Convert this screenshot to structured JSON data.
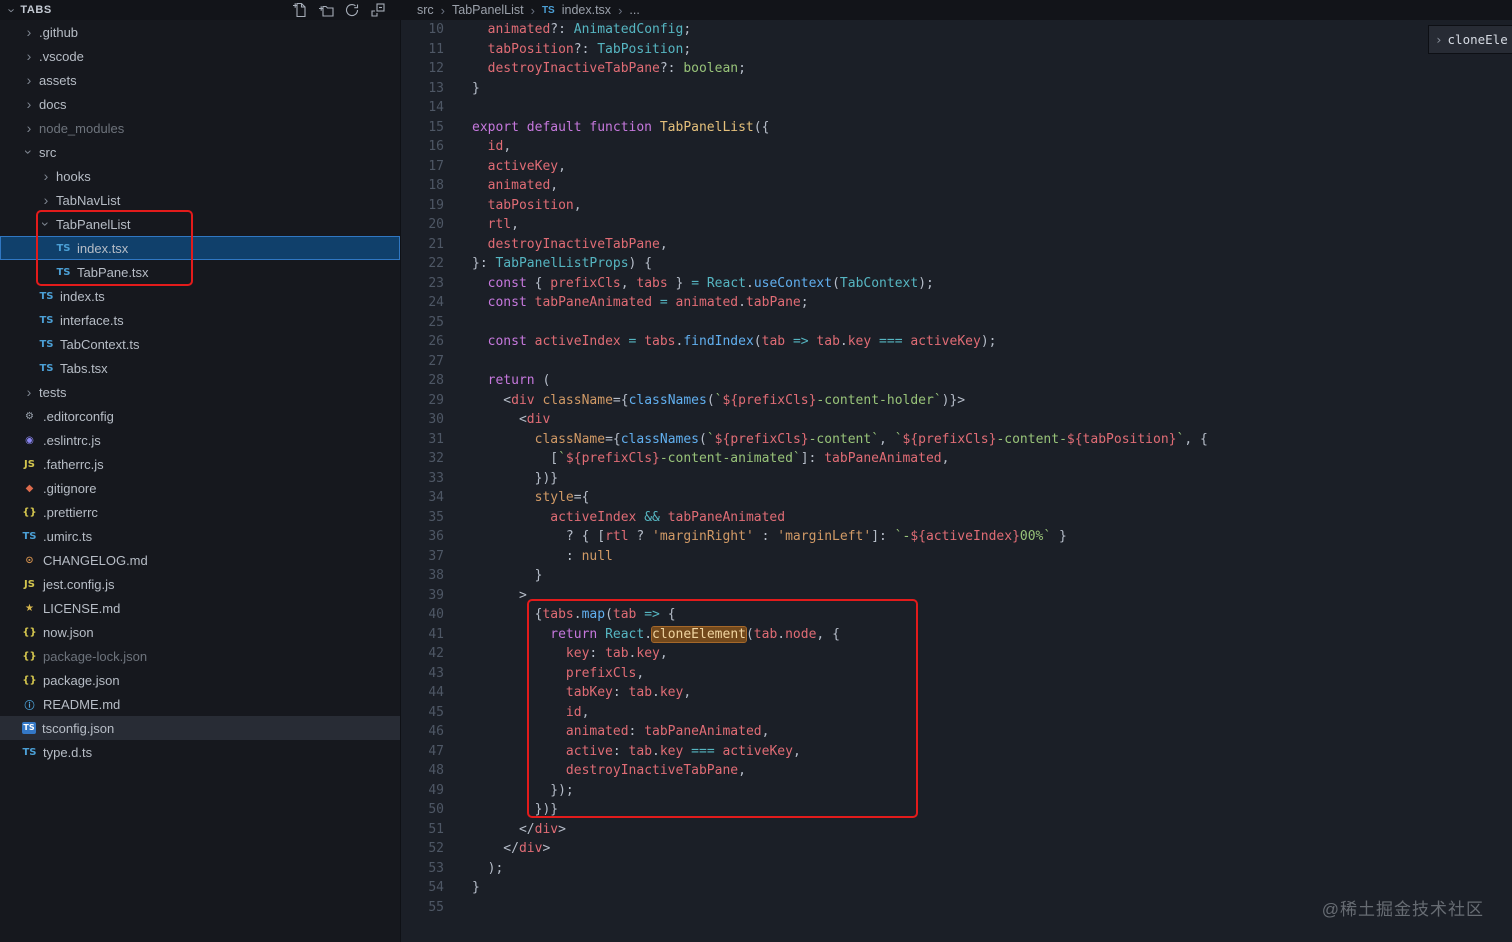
{
  "explorer": {
    "title": "TABS",
    "actions": [
      "new-file-icon",
      "new-folder-icon",
      "refresh-icon",
      "collapse-all-icon"
    ],
    "items": [
      {
        "label": ".github",
        "kind": "folder",
        "level": 0
      },
      {
        "label": ".vscode",
        "kind": "folder",
        "level": 0
      },
      {
        "label": "assets",
        "kind": "folder",
        "level": 0
      },
      {
        "label": "docs",
        "kind": "folder",
        "level": 0
      },
      {
        "label": "node_modules",
        "kind": "folder",
        "level": 0,
        "dim": true
      },
      {
        "label": "src",
        "kind": "folder",
        "level": 0,
        "expanded": true
      },
      {
        "label": "hooks",
        "kind": "folder",
        "level": 1
      },
      {
        "label": "TabNavList",
        "kind": "folder",
        "level": 1
      },
      {
        "label": "TabPanelList",
        "kind": "folder",
        "level": 1,
        "expanded": true
      },
      {
        "label": "index.tsx",
        "kind": "file",
        "icon": "ts",
        "level": 2,
        "selected": true
      },
      {
        "label": "TabPane.tsx",
        "kind": "file",
        "icon": "ts",
        "level": 2
      },
      {
        "label": "index.ts",
        "kind": "file",
        "icon": "ts",
        "level": 1
      },
      {
        "label": "interface.ts",
        "kind": "file",
        "icon": "ts",
        "level": 1
      },
      {
        "label": "TabContext.ts",
        "kind": "file",
        "icon": "ts",
        "level": 1
      },
      {
        "label": "Tabs.tsx",
        "kind": "file",
        "icon": "ts",
        "level": 1
      },
      {
        "label": "tests",
        "kind": "folder",
        "level": 0
      },
      {
        "label": ".editorconfig",
        "kind": "file",
        "icon": "gear",
        "level": 0
      },
      {
        "label": ".eslintrc.js",
        "kind": "file",
        "icon": "eslint",
        "level": 0
      },
      {
        "label": ".fatherrc.js",
        "kind": "file",
        "icon": "js",
        "level": 0
      },
      {
        "label": ".gitignore",
        "kind": "file",
        "icon": "git",
        "level": 0
      },
      {
        "label": ".prettierrc",
        "kind": "file",
        "icon": "json",
        "level": 0
      },
      {
        "label": ".umirc.ts",
        "kind": "file",
        "icon": "ts",
        "level": 0
      },
      {
        "label": "CHANGELOG.md",
        "kind": "file",
        "icon": "changelog",
        "level": 0
      },
      {
        "label": "jest.config.js",
        "kind": "file",
        "icon": "js",
        "level": 0
      },
      {
        "label": "LICENSE.md",
        "kind": "file",
        "icon": "license",
        "level": 0
      },
      {
        "label": "now.json",
        "kind": "file",
        "icon": "json",
        "level": 0
      },
      {
        "label": "package-lock.json",
        "kind": "file",
        "icon": "json",
        "level": 0,
        "dim": true
      },
      {
        "label": "package.json",
        "kind": "file",
        "icon": "json",
        "level": 0
      },
      {
        "label": "README.md",
        "kind": "file",
        "icon": "info",
        "level": 0
      },
      {
        "label": "tsconfig.json",
        "kind": "file",
        "icon": "tsconfig",
        "level": 0,
        "active": true
      },
      {
        "label": "type.d.ts",
        "kind": "file",
        "icon": "ts",
        "level": 0
      }
    ]
  },
  "icon_glyphs": {
    "ts": {
      "glyph": "TS",
      "color": "#4b9fd5"
    },
    "tsconfig": {
      "glyph": "TS",
      "color": "#ffffff",
      "bg": "#3478c6"
    },
    "js": {
      "glyph": "JS",
      "color": "#d4c64e"
    },
    "json": {
      "glyph": "{}",
      "color": "#d4c64e"
    },
    "gear": {
      "glyph": "⚙",
      "color": "#9da5b0"
    },
    "eslint": {
      "glyph": "◉",
      "color": "#8a85f0"
    },
    "git": {
      "glyph": "◆",
      "color": "#dd6b4d"
    },
    "info": {
      "glyph": "ⓘ",
      "color": "#4b9fd5"
    },
    "changelog": {
      "glyph": "⊙",
      "color": "#c98a4b"
    },
    "license": {
      "glyph": "★",
      "color": "#d8b84e"
    },
    "ts_badge": "TS"
  },
  "breadcrumb": {
    "parts": [
      "src",
      "TabPanelList",
      "index.tsx",
      "..."
    ]
  },
  "peek_widget": {
    "text": "cloneEle"
  },
  "watermark": {
    "text": "@稀土掘金技术社区"
  },
  "editor": {
    "first_line": 10,
    "lines": [
      [
        [
          "pl",
          "  "
        ],
        [
          "va",
          "animated"
        ],
        [
          "pl",
          "?: "
        ],
        [
          "ty",
          "AnimatedConfig"
        ],
        [
          "pl",
          ";"
        ]
      ],
      [
        [
          "pl",
          "  "
        ],
        [
          "va",
          "tabPosition"
        ],
        [
          "pl",
          "?: "
        ],
        [
          "ty",
          "TabPosition"
        ],
        [
          "pl",
          ";"
        ]
      ],
      [
        [
          "pl",
          "  "
        ],
        [
          "va",
          "destroyInactiveTabPane"
        ],
        [
          "pl",
          "?: "
        ],
        [
          "st",
          "boolean"
        ],
        [
          "pl",
          ";"
        ]
      ],
      [
        [
          "pl",
          "}"
        ]
      ],
      [],
      [
        [
          "kw",
          "export default function "
        ],
        [
          "au",
          "TabPanelList"
        ],
        [
          "pl",
          "({"
        ]
      ],
      [
        [
          "pl",
          "  "
        ],
        [
          "va",
          "id"
        ],
        [
          "pl",
          ","
        ]
      ],
      [
        [
          "pl",
          "  "
        ],
        [
          "va",
          "activeKey"
        ],
        [
          "pl",
          ","
        ]
      ],
      [
        [
          "pl",
          "  "
        ],
        [
          "va",
          "animated"
        ],
        [
          "pl",
          ","
        ]
      ],
      [
        [
          "pl",
          "  "
        ],
        [
          "va",
          "tabPosition"
        ],
        [
          "pl",
          ","
        ]
      ],
      [
        [
          "pl",
          "  "
        ],
        [
          "va",
          "rtl"
        ],
        [
          "pl",
          ","
        ]
      ],
      [
        [
          "pl",
          "  "
        ],
        [
          "va",
          "destroyInactiveTabPane"
        ],
        [
          "pl",
          ","
        ]
      ],
      [
        [
          "pl",
          "}: "
        ],
        [
          "ty",
          "TabPanelListProps"
        ],
        [
          "pl",
          ") {"
        ]
      ],
      [
        [
          "pl",
          "  "
        ],
        [
          "kw",
          "const"
        ],
        [
          "pl",
          " { "
        ],
        [
          "va",
          "prefixCls"
        ],
        [
          "pl",
          ", "
        ],
        [
          "va",
          "tabs"
        ],
        [
          "pl",
          " } "
        ],
        [
          "op",
          "="
        ],
        [
          "pl",
          " "
        ],
        [
          "ty",
          "React"
        ],
        [
          "pl",
          "."
        ],
        [
          "fn",
          "useContext"
        ],
        [
          "pl",
          "("
        ],
        [
          "ty",
          "TabContext"
        ],
        [
          "pl",
          ");"
        ]
      ],
      [
        [
          "pl",
          "  "
        ],
        [
          "kw",
          "const"
        ],
        [
          "pl",
          " "
        ],
        [
          "va",
          "tabPaneAnimated"
        ],
        [
          "pl",
          " "
        ],
        [
          "op",
          "="
        ],
        [
          "pl",
          " "
        ],
        [
          "va",
          "animated"
        ],
        [
          "pl",
          "."
        ],
        [
          "va",
          "tabPane"
        ],
        [
          "pl",
          ";"
        ]
      ],
      [],
      [
        [
          "pl",
          "  "
        ],
        [
          "kw",
          "const"
        ],
        [
          "pl",
          " "
        ],
        [
          "va",
          "activeIndex"
        ],
        [
          "pl",
          " "
        ],
        [
          "op",
          "="
        ],
        [
          "pl",
          " "
        ],
        [
          "va",
          "tabs"
        ],
        [
          "pl",
          "."
        ],
        [
          "fn",
          "findIndex"
        ],
        [
          "pl",
          "("
        ],
        [
          "va",
          "tab"
        ],
        [
          "pl",
          " "
        ],
        [
          "op",
          "=>"
        ],
        [
          "pl",
          " "
        ],
        [
          "va",
          "tab"
        ],
        [
          "pl",
          "."
        ],
        [
          "va",
          "key"
        ],
        [
          "pl",
          " "
        ],
        [
          "op",
          "==="
        ],
        [
          "pl",
          " "
        ],
        [
          "va",
          "activeKey"
        ],
        [
          "pl",
          ");"
        ]
      ],
      [],
      [
        [
          "pl",
          "  "
        ],
        [
          "kw",
          "return"
        ],
        [
          "pl",
          " ("
        ]
      ],
      [
        [
          "pl",
          "    <"
        ],
        [
          "tg",
          "div"
        ],
        [
          "pl",
          " "
        ],
        [
          "at",
          "className"
        ],
        [
          "pl",
          "={"
        ],
        [
          "fn",
          "classNames"
        ],
        [
          "pl",
          "("
        ],
        [
          "st",
          "`"
        ],
        [
          "va",
          "${prefixCls}"
        ],
        [
          "st",
          "-content-holder`"
        ],
        [
          "pl",
          ")}>"
        ]
      ],
      [
        [
          "pl",
          "      <"
        ],
        [
          "tg",
          "div"
        ]
      ],
      [
        [
          "pl",
          "        "
        ],
        [
          "at",
          "className"
        ],
        [
          "pl",
          "={"
        ],
        [
          "fn",
          "classNames"
        ],
        [
          "pl",
          "("
        ],
        [
          "st",
          "`"
        ],
        [
          "va",
          "${prefixCls}"
        ],
        [
          "st",
          "-content`"
        ],
        [
          "pl",
          ", "
        ],
        [
          "st",
          "`"
        ],
        [
          "va",
          "${prefixCls}"
        ],
        [
          "st",
          "-content-"
        ],
        [
          "va",
          "${tabPosition}"
        ],
        [
          "st",
          "`"
        ],
        [
          "pl",
          ", {"
        ]
      ],
      [
        [
          "pl",
          "          ["
        ],
        [
          "st",
          "`"
        ],
        [
          "va",
          "${prefixCls}"
        ],
        [
          "st",
          "-content-animated`"
        ],
        [
          "pl",
          "]: "
        ],
        [
          "va",
          "tabPaneAnimated"
        ],
        [
          "pl",
          ","
        ]
      ],
      [
        [
          "pl",
          "        })}"
        ]
      ],
      [
        [
          "pl",
          "        "
        ],
        [
          "at",
          "style"
        ],
        [
          "pl",
          "={"
        ]
      ],
      [
        [
          "pl",
          "          "
        ],
        [
          "va",
          "activeIndex"
        ],
        [
          "pl",
          " "
        ],
        [
          "op",
          "&&"
        ],
        [
          "pl",
          " "
        ],
        [
          "va",
          "tabPaneAnimated"
        ]
      ],
      [
        [
          "pl",
          "            ? { ["
        ],
        [
          "va",
          "rtl"
        ],
        [
          "pl",
          " ? "
        ],
        [
          "or",
          "'marginRight'"
        ],
        [
          "pl",
          " : "
        ],
        [
          "or",
          "'marginLeft'"
        ],
        [
          "pl",
          "]: "
        ],
        [
          "st",
          "`-"
        ],
        [
          "va",
          "${activeIndex}"
        ],
        [
          "st",
          "00%`"
        ],
        [
          "pl",
          " }"
        ]
      ],
      [
        [
          "pl",
          "            : "
        ],
        [
          "or",
          "null"
        ]
      ],
      [
        [
          "pl",
          "        }"
        ]
      ],
      [
        [
          "pl",
          "      >"
        ]
      ],
      [
        [
          "pl",
          "        {"
        ],
        [
          "va",
          "tabs"
        ],
        [
          "pl",
          "."
        ],
        [
          "fn",
          "map"
        ],
        [
          "pl",
          "("
        ],
        [
          "va",
          "tab"
        ],
        [
          "pl",
          " "
        ],
        [
          "op",
          "=>"
        ],
        [
          "pl",
          " {"
        ]
      ],
      [
        [
          "pl",
          "          "
        ],
        [
          "kw",
          "return"
        ],
        [
          "pl",
          " "
        ],
        [
          "ty",
          "React"
        ],
        [
          "pl",
          "."
        ],
        [
          "hl",
          "cloneElement"
        ],
        [
          "pl",
          "("
        ],
        [
          "va",
          "tab"
        ],
        [
          "pl",
          "."
        ],
        [
          "va",
          "node"
        ],
        [
          "pl",
          ", {"
        ]
      ],
      [
        [
          "pl",
          "            "
        ],
        [
          "va",
          "key"
        ],
        [
          "pl",
          ": "
        ],
        [
          "va",
          "tab"
        ],
        [
          "pl",
          "."
        ],
        [
          "va",
          "key"
        ],
        [
          "pl",
          ","
        ]
      ],
      [
        [
          "pl",
          "            "
        ],
        [
          "va",
          "prefixCls"
        ],
        [
          "pl",
          ","
        ]
      ],
      [
        [
          "pl",
          "            "
        ],
        [
          "va",
          "tabKey"
        ],
        [
          "pl",
          ": "
        ],
        [
          "va",
          "tab"
        ],
        [
          "pl",
          "."
        ],
        [
          "va",
          "key"
        ],
        [
          "pl",
          ","
        ]
      ],
      [
        [
          "pl",
          "            "
        ],
        [
          "va",
          "id"
        ],
        [
          "pl",
          ","
        ]
      ],
      [
        [
          "pl",
          "            "
        ],
        [
          "va",
          "animated"
        ],
        [
          "pl",
          ": "
        ],
        [
          "va",
          "tabPaneAnimated"
        ],
        [
          "pl",
          ","
        ]
      ],
      [
        [
          "pl",
          "            "
        ],
        [
          "va",
          "active"
        ],
        [
          "pl",
          ": "
        ],
        [
          "va",
          "tab"
        ],
        [
          "pl",
          "."
        ],
        [
          "va",
          "key"
        ],
        [
          "pl",
          " "
        ],
        [
          "op",
          "==="
        ],
        [
          "pl",
          " "
        ],
        [
          "va",
          "activeKey"
        ],
        [
          "pl",
          ","
        ]
      ],
      [
        [
          "pl",
          "            "
        ],
        [
          "va",
          "destroyInactiveTabPane"
        ],
        [
          "pl",
          ","
        ]
      ],
      [
        [
          "pl",
          "          });"
        ]
      ],
      [
        [
          "pl",
          "        })}"
        ]
      ],
      [
        [
          "pl",
          "      </"
        ],
        [
          "tg",
          "div"
        ],
        [
          "pl",
          ">"
        ]
      ],
      [
        [
          "pl",
          "    </"
        ],
        [
          "tg",
          "div"
        ],
        [
          "pl",
          ">"
        ]
      ],
      [
        [
          "pl",
          "  );"
        ]
      ],
      [
        [
          "pl",
          "}"
        ]
      ],
      []
    ]
  }
}
